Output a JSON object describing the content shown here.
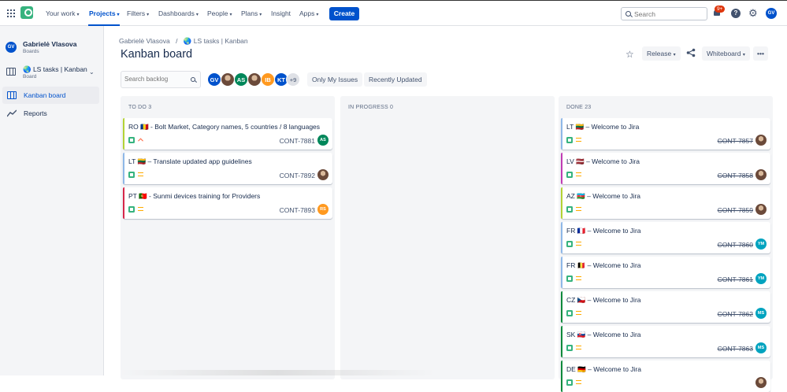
{
  "topnav": {
    "items": [
      {
        "label": "Your work",
        "chevron": true
      },
      {
        "label": "Projects",
        "chevron": true,
        "active": true
      },
      {
        "label": "Filters",
        "chevron": true
      },
      {
        "label": "Dashboards",
        "chevron": true
      },
      {
        "label": "People",
        "chevron": true
      },
      {
        "label": "Plans",
        "chevron": true
      },
      {
        "label": "Insight",
        "chevron": false
      },
      {
        "label": "Apps",
        "chevron": true
      }
    ],
    "create_label": "Create",
    "search_placeholder": "Search",
    "notification_count": "9+",
    "help_glyph": "?",
    "user_initials": "GV",
    "accent": "#0052cc"
  },
  "sidebar": {
    "user_initials": "GV",
    "user_name": "Gabrielė Vlasova",
    "user_sub": "Boards",
    "project_name": "🌏 LS tasks | Kanban",
    "project_sub": "Board",
    "items": [
      {
        "label": "Kanban board",
        "icon": "board-icon",
        "selected": true
      },
      {
        "label": "Reports",
        "icon": "reports-icon",
        "selected": false
      }
    ]
  },
  "main": {
    "breadcrumb": [
      "Gabrielė Vlasova",
      "/",
      "🌏 LS tasks | Kanban"
    ],
    "title": "Kanban board",
    "release_label": "Release",
    "whiteboard_label": "Whiteboard",
    "more_label": "•••",
    "backlog_placeholder": "Search backlog",
    "avatars": [
      {
        "initials": "GV",
        "color": "#0052cc",
        "photo": false
      },
      {
        "initials": "",
        "color": "#6b4a3a",
        "photo": true
      },
      {
        "initials": "AS",
        "color": "#00875a",
        "photo": false
      },
      {
        "initials": "",
        "color": "#8a6a55",
        "photo": true
      },
      {
        "initials": "IB",
        "color": "#ff991f",
        "photo": false
      },
      {
        "initials": "KT",
        "color": "#0052cc",
        "photo": false
      },
      {
        "initials": "+9",
        "color": "#dfe1e6",
        "photo": false
      }
    ],
    "filters": [
      "Only My Issues",
      "Recently Updated"
    ]
  },
  "columns": [
    {
      "name": "TO DO",
      "count": "3",
      "cards": [
        {
          "title": "RO 🇷🇴 - Bolt Market, Category names, 5 countries / 8 languages",
          "key": "CONT-7881",
          "stripe": "#b3d335",
          "priority": "low",
          "assignee": "AS",
          "assignee_color": "#00875a",
          "done": false
        },
        {
          "title": "LT 🇱🇹 – Translate updated app guidelines",
          "key": "CONT-7892",
          "stripe": "#8fb8e8",
          "priority": "medium",
          "assignee": "",
          "assignee_color": "#6b4a3a",
          "done": false
        },
        {
          "title": "PT 🇵🇹 - Sunmi devices training for Providers",
          "key": "CONT-7893",
          "stripe": "#d6264a",
          "priority": "medium",
          "assignee": "RS",
          "assignee_color": "#ff991f",
          "done": false
        }
      ]
    },
    {
      "name": "IN PROGRESS",
      "count": "0",
      "cards": []
    },
    {
      "name": "DONE",
      "count": "23",
      "cards": [
        {
          "title": "LT 🇱🇹 – Welcome to Jira",
          "key": "CONT-7857",
          "stripe": "#8fb8e8",
          "priority": "medium",
          "assignee": "",
          "assignee_color": "#6b4a3a",
          "done": true
        },
        {
          "title": "LV 🇱🇻 – Welcome to Jira",
          "key": "CONT-7858",
          "stripe": "#c13cb4",
          "priority": "medium",
          "assignee": "",
          "assignee_color": "#8a5a45",
          "done": true
        },
        {
          "title": "AZ 🇦🇿 – Welcome to Jira",
          "key": "CONT-7859",
          "stripe": "#b3d335",
          "priority": "medium",
          "assignee": "",
          "assignee_color": "#8a6a55",
          "done": true
        },
        {
          "title": "FR 🇫🇷 – Welcome to Jira",
          "key": "CONT-7860",
          "stripe": "#8fb8e8",
          "priority": "medium",
          "assignee": "YM",
          "assignee_color": "#00a3bf",
          "done": true
        },
        {
          "title": "FR 🇧🇪 – Welcome to Jira",
          "key": "CONT-7861",
          "stripe": "#8fb8e8",
          "priority": "medium",
          "assignee": "YM",
          "assignee_color": "#00a3bf",
          "done": true
        },
        {
          "title": "CZ 🇨🇿 – Welcome to Jira",
          "key": "CONT-7862",
          "stripe": "#0e8a3c",
          "priority": "medium",
          "assignee": "MS",
          "assignee_color": "#00a3bf",
          "done": true
        },
        {
          "title": "SK 🇸🇰 – Welcome to Jira",
          "key": "CONT-7863",
          "stripe": "#0e8a3c",
          "priority": "medium",
          "assignee": "MS",
          "assignee_color": "#00a3bf",
          "done": true
        },
        {
          "title": "DE 🇩🇪 – Welcome to Jira",
          "key": "",
          "stripe": "#0e8a3c",
          "priority": "medium",
          "assignee": "",
          "assignee_color": "#00a3bf",
          "done": true
        }
      ]
    }
  ]
}
